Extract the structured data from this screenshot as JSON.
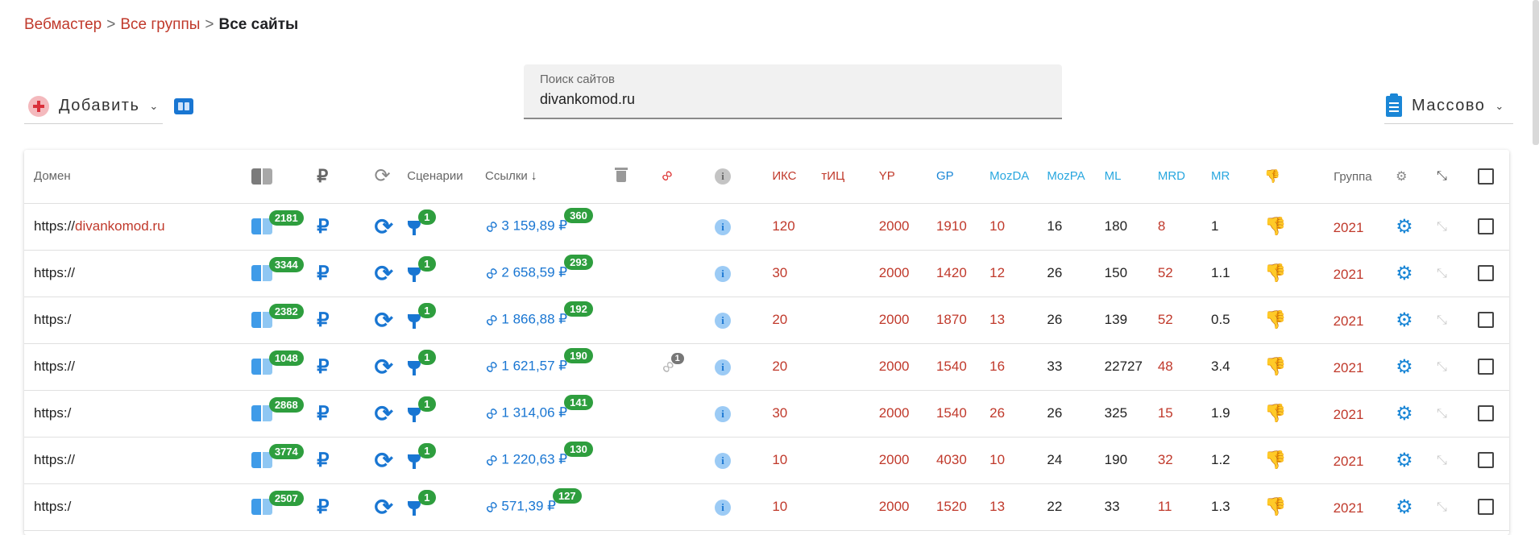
{
  "breadcrumb": {
    "items": [
      "Вебмастер",
      "Все группы"
    ],
    "separator": ">",
    "current": "Все сайты"
  },
  "toolbar": {
    "add_label": "Добавить",
    "mass_label": "Массово"
  },
  "search": {
    "label": "Поиск сайтов",
    "value": "divankomod.ru"
  },
  "table": {
    "headers": {
      "domain": "Домен",
      "scenarios": "Сценарии",
      "links": "Ссылки",
      "iks": "ИКС",
      "tic": "тИЦ",
      "yp": "YP",
      "gp": "GP",
      "mozda": "MozDA",
      "mozpa": "MozPA",
      "ml": "ML",
      "mrd": "MRD",
      "mr": "MR",
      "group": "Группа"
    },
    "rows": [
      {
        "prefix": "https://",
        "domain": "divankomod.ru",
        "pages": "2181",
        "scenarios": "1",
        "money": "3 159,89 ₽",
        "links": "360",
        "extra": "",
        "iks": "120",
        "tic": "",
        "yp": "2000",
        "gp": "1910",
        "mozda": "10",
        "mozpa": "16",
        "ml": "180",
        "mrd": "8",
        "mr": "1",
        "group": "2021"
      },
      {
        "prefix": "https://",
        "domain": "",
        "pages": "3344",
        "scenarios": "1",
        "money": "2 658,59 ₽",
        "links": "293",
        "extra": "",
        "iks": "30",
        "tic": "",
        "yp": "2000",
        "gp": "1420",
        "mozda": "12",
        "mozpa": "26",
        "ml": "150",
        "mrd": "52",
        "mr": "1.1",
        "group": "2021"
      },
      {
        "prefix": "https:/",
        "domain": "",
        "pages": "2382",
        "scenarios": "1",
        "money": "1 866,88 ₽",
        "links": "192",
        "extra": "",
        "iks": "20",
        "tic": "",
        "yp": "2000",
        "gp": "1870",
        "mozda": "13",
        "mozpa": "26",
        "ml": "139",
        "mrd": "52",
        "mr": "0.5",
        "group": "2021"
      },
      {
        "prefix": "https://",
        "domain": "",
        "pages": "1048",
        "scenarios": "1",
        "money": "1 621,57 ₽",
        "links": "190",
        "extra": "1",
        "iks": "20",
        "tic": "",
        "yp": "2000",
        "gp": "1540",
        "mozda": "16",
        "mozpa": "33",
        "ml": "22727",
        "mrd": "48",
        "mr": "3.4",
        "group": "2021"
      },
      {
        "prefix": "https:/",
        "domain": "",
        "pages": "2868",
        "scenarios": "1",
        "money": "1 314,06 ₽",
        "links": "141",
        "extra": "",
        "iks": "30",
        "tic": "",
        "yp": "2000",
        "gp": "1540",
        "mozda": "26",
        "mozpa": "26",
        "ml": "325",
        "mrd": "15",
        "mr": "1.9",
        "group": "2021"
      },
      {
        "prefix": "https://",
        "domain": "",
        "pages": "3774",
        "scenarios": "1",
        "money": "1 220,63 ₽",
        "links": "130",
        "extra": "",
        "iks": "10",
        "tic": "",
        "yp": "2000",
        "gp": "4030",
        "mozda": "10",
        "mozpa": "24",
        "ml": "190",
        "mrd": "32",
        "mr": "1.2",
        "group": "2021"
      },
      {
        "prefix": "https:/",
        "domain": "",
        "pages": "2507",
        "scenarios": "1",
        "money": "571,39 ₽",
        "links": "127",
        "extra": "",
        "iks": "10",
        "tic": "",
        "yp": "2000",
        "gp": "1520",
        "mozda": "13",
        "mozpa": "22",
        "ml": "33",
        "mrd": "11",
        "mr": "1.3",
        "group": "2021"
      }
    ]
  },
  "icons": {
    "add": "plus-circle-icon",
    "view": "columns-icon",
    "mass": "clipboard-icon",
    "book": "book-icon",
    "ruble": "ruble-icon",
    "refresh": "refresh-icon",
    "plug": "plug-icon",
    "link": "link-icon",
    "info": "info-icon",
    "thumb": "thumbs-down-icon",
    "gear": "gear-icon",
    "pin": "pin-icon",
    "trash": "trash-icon"
  },
  "colors": {
    "accent_red": "#c0392b",
    "accent_blue": "#1976d2",
    "badge_green": "#2e9e3e"
  }
}
